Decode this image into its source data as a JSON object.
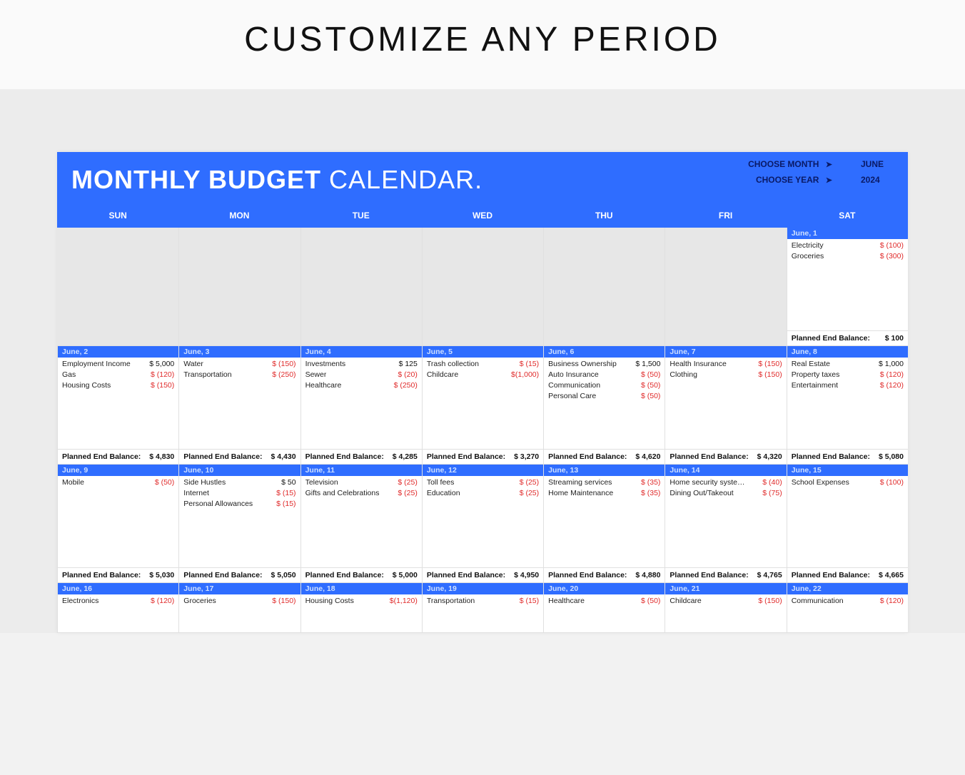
{
  "page": {
    "heading": "CUSTOMIZE ANY PERIOD"
  },
  "header": {
    "title_bold": "MONTHLY BUDGET",
    "title_light": " CALENDAR.",
    "choose_month_label": "CHOOSE MONTH",
    "choose_year_label": "CHOOSE YEAR",
    "month_value": "JUNE",
    "year_value": "2024"
  },
  "weekdays": [
    "SUN",
    "MON",
    "TUE",
    "WED",
    "THU",
    "FRI",
    "SAT"
  ],
  "planned_end_label": "Planned End Balance:",
  "rows": [
    {
      "cells": [
        {
          "empty": true
        },
        {
          "empty": true
        },
        {
          "empty": true
        },
        {
          "empty": true
        },
        {
          "empty": true
        },
        {
          "empty": true
        },
        {
          "date": "June, 1",
          "items": [
            {
              "name": "Electricity",
              "amt": "$   (100)",
              "neg": true
            },
            {
              "name": "Groceries",
              "amt": "$   (300)",
              "neg": true
            }
          ],
          "balance": "$   100"
        }
      ]
    },
    {
      "cells": [
        {
          "date": "June, 2",
          "items": [
            {
              "name": "Employment Income",
              "amt": "$ 5,000",
              "neg": false
            },
            {
              "name": "Gas",
              "amt": "$   (120)",
              "neg": true
            },
            {
              "name": "Housing Costs",
              "amt": "$   (150)",
              "neg": true
            }
          ],
          "balance": "$ 4,830"
        },
        {
          "date": "June, 3",
          "items": [
            {
              "name": "Water",
              "amt": "$   (150)",
              "neg": true
            },
            {
              "name": "Transportation",
              "amt": "$   (250)",
              "neg": true
            }
          ],
          "balance": "$ 4,430"
        },
        {
          "date": "June, 4",
          "items": [
            {
              "name": "Investments",
              "amt": "$    125",
              "neg": false
            },
            {
              "name": "Sewer",
              "amt": "$    (20)",
              "neg": true
            },
            {
              "name": "Healthcare",
              "amt": "$   (250)",
              "neg": true
            }
          ],
          "balance": "$ 4,285"
        },
        {
          "date": "June, 5",
          "items": [
            {
              "name": "Trash collection",
              "amt": "$    (15)",
              "neg": true
            },
            {
              "name": "Childcare",
              "amt": "$(1,000)",
              "neg": true
            }
          ],
          "balance": "$ 3,270"
        },
        {
          "date": "June, 6",
          "items": [
            {
              "name": "Business Ownership",
              "amt": "$ 1,500",
              "neg": false
            },
            {
              "name": "Auto Insurance",
              "amt": "$    (50)",
              "neg": true
            },
            {
              "name": "Communication",
              "amt": "$    (50)",
              "neg": true
            },
            {
              "name": "Personal Care",
              "amt": "$    (50)",
              "neg": true
            }
          ],
          "balance": "$ 4,620"
        },
        {
          "date": "June, 7",
          "items": [
            {
              "name": "Health Insurance",
              "amt": "$   (150)",
              "neg": true
            },
            {
              "name": "Clothing",
              "amt": "$   (150)",
              "neg": true
            }
          ],
          "balance": "$ 4,320"
        },
        {
          "date": "June, 8",
          "items": [
            {
              "name": "Real Estate",
              "amt": "$ 1,000",
              "neg": false
            },
            {
              "name": "Property taxes",
              "amt": "$   (120)",
              "neg": true
            },
            {
              "name": "Entertainment",
              "amt": "$   (120)",
              "neg": true
            }
          ],
          "balance": "$ 5,080"
        }
      ]
    },
    {
      "cells": [
        {
          "date": "June, 9",
          "items": [
            {
              "name": "Mobile",
              "amt": "$    (50)",
              "neg": true
            }
          ],
          "balance": "$ 5,030"
        },
        {
          "date": "June, 10",
          "items": [
            {
              "name": "Side Hustles",
              "amt": "$     50",
              "neg": false
            },
            {
              "name": "Internet",
              "amt": "$    (15)",
              "neg": true
            },
            {
              "name": "Personal Allowances",
              "amt": "$    (15)",
              "neg": true
            }
          ],
          "balance": "$ 5,050"
        },
        {
          "date": "June, 11",
          "items": [
            {
              "name": "Television",
              "amt": "$    (25)",
              "neg": true
            },
            {
              "name": "Gifts and Celebrations",
              "amt": "$    (25)",
              "neg": true
            }
          ],
          "balance": "$ 5,000"
        },
        {
          "date": "June, 12",
          "items": [
            {
              "name": "Toll fees",
              "amt": "$    (25)",
              "neg": true
            },
            {
              "name": "Education",
              "amt": "$    (25)",
              "neg": true
            }
          ],
          "balance": "$ 4,950"
        },
        {
          "date": "June, 13",
          "items": [
            {
              "name": "Streaming services",
              "amt": "$    (35)",
              "neg": true
            },
            {
              "name": "Home Maintenance",
              "amt": "$    (35)",
              "neg": true
            }
          ],
          "balance": "$ 4,880"
        },
        {
          "date": "June, 14",
          "items": [
            {
              "name": "Home security systems",
              "amt": "$    (40)",
              "neg": true
            },
            {
              "name": "Dining Out/Takeout",
              "amt": "$    (75)",
              "neg": true
            }
          ],
          "balance": "$ 4,765"
        },
        {
          "date": "June, 15",
          "items": [
            {
              "name": "School Expenses",
              "amt": "$   (100)",
              "neg": true
            }
          ],
          "balance": "$ 4,665"
        }
      ]
    },
    {
      "short": true,
      "cells": [
        {
          "date": "June, 16",
          "items": [
            {
              "name": "Electronics",
              "amt": "$   (120)",
              "neg": true
            }
          ]
        },
        {
          "date": "June, 17",
          "items": [
            {
              "name": "Groceries",
              "amt": "$   (150)",
              "neg": true
            }
          ]
        },
        {
          "date": "June, 18",
          "items": [
            {
              "name": "Housing Costs",
              "amt": "$(1,120)",
              "neg": true
            }
          ]
        },
        {
          "date": "June, 19",
          "items": [
            {
              "name": "Transportation",
              "amt": "$    (15)",
              "neg": true
            }
          ]
        },
        {
          "date": "June, 20",
          "items": [
            {
              "name": "Healthcare",
              "amt": "$    (50)",
              "neg": true
            }
          ]
        },
        {
          "date": "June, 21",
          "items": [
            {
              "name": "Childcare",
              "amt": "$   (150)",
              "neg": true
            }
          ]
        },
        {
          "date": "June, 22",
          "items": [
            {
              "name": "Communication",
              "amt": "$   (120)",
              "neg": true
            }
          ]
        }
      ]
    }
  ]
}
